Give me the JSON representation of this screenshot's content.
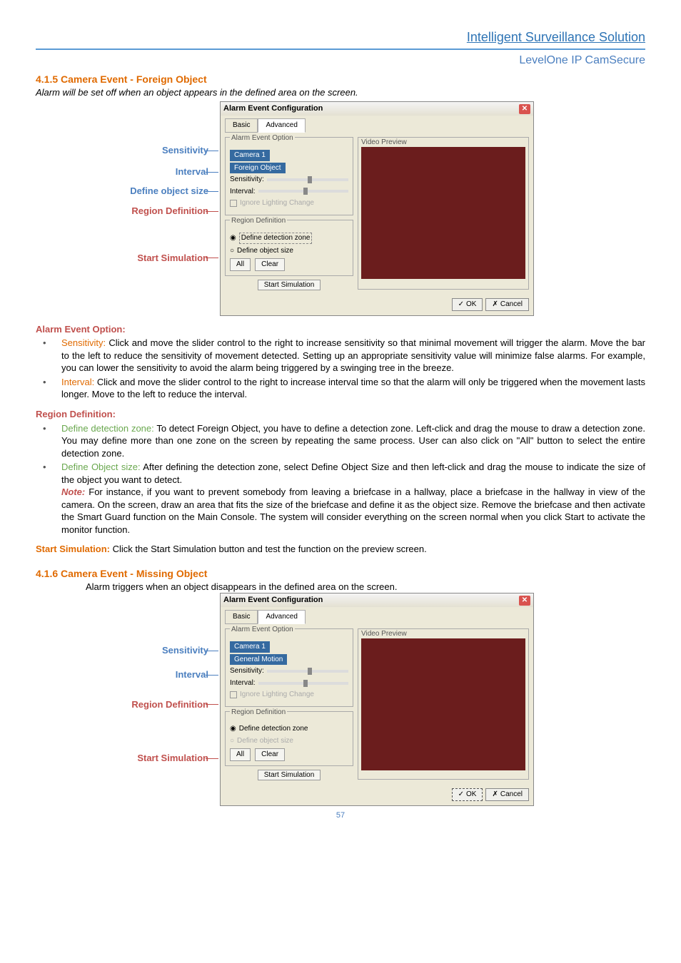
{
  "header": {
    "title1": "Intelligent Surveillance Solution",
    "title2": "LevelOne IP CamSecure"
  },
  "sec415": {
    "heading": "4.1.5 Camera Event - Foreign Object",
    "lede": "Alarm will be set off when an object appears in the defined area on the screen."
  },
  "ann": {
    "sens": "Sensitivity",
    "interval": "Interval",
    "defobj": "Define object size",
    "region": "Region Definition",
    "start": "Start Simulation"
  },
  "dlgA": {
    "title": "Alarm Event Configuration",
    "tab_basic": "Basic",
    "tab_adv": "Advanced",
    "grp_alarm": "Alarm Event Option",
    "grp_preview": "Video Preview",
    "camera": "Camera 1",
    "event": "Foreign Object",
    "lbl_sens": "Sensitivity:",
    "lbl_int": "Interval:",
    "chk_ignore": "Ignore Lighting Change",
    "grp_region": "Region Definition",
    "rad_ddz": "Define detection zone",
    "rad_dos": "Define object size",
    "btn_all": "All",
    "btn_clear": "Clear",
    "btn_start": "Start Simulation",
    "btn_ok": "OK",
    "btn_cancel": "Cancel"
  },
  "body415": {
    "aeo_head": "Alarm Event Option:",
    "sens_term": "Sensitivity:",
    "sens_text": " Click and move the slider control to the right to increase sensitivity so that minimal movement will trigger the alarm. Move the bar to the left to reduce the sensitivity of movement detected. Setting up an appropriate sensitivity value will minimize false alarms. For example, you can lower the sensitivity to avoid the alarm being triggered by a swinging tree in the breeze.",
    "int_term": "Interval:",
    "int_text": " Click and move the slider control to the right to increase interval time so that the alarm will only be triggered when the movement lasts longer. Move to the left to reduce the interval.",
    "reg_head": "Region Definition:",
    "ddz_term": "Define detection zone:",
    "ddz_text": " To detect Foreign Object, you have to define a detection zone. Left-click and drag the mouse to draw a detection zone. You may define more than one zone on the screen by repeating the same process. User can also click on \"All\" button to select the entire detection zone.",
    "dos_term": "Define Object size:",
    "dos_text": " After defining the detection zone, select Define Object Size and then left-click and drag the mouse to indicate the size of the object you want to detect.",
    "note": "Note:",
    "note_text": " For instance, if you want to prevent somebody from leaving a briefcase in a hallway, place a briefcase in the hallway in view of the camera. On the screen, draw an area that fits the size of the briefcase and define it as the object size.    Remove the briefcase and then activate the Smart Guard function on the Main Console. The system will consider everything on the screen normal when you click Start to activate the monitor function.",
    "start_head": "Start Simulation:",
    "start_text": " Click the Start Simulation button and test the function on the preview screen."
  },
  "sec416": {
    "heading": "4.1.6 Camera Event - Missing Object",
    "lede": "Alarm triggers when an object disappears in the defined area on the screen."
  },
  "dlgB": {
    "title": "Alarm Event Configuration",
    "tab_basic": "Basic",
    "tab_adv": "Advanced",
    "grp_alarm": "Alarm Event Option",
    "grp_preview": "Video Preview",
    "camera": "Camera 1",
    "event": "General Motion",
    "lbl_sens": "Sensitivity:",
    "lbl_int": "Interval:",
    "chk_ignore": "Ignore Lighting Change",
    "grp_region": "Region Definition",
    "rad_ddz": "Define detection zone",
    "rad_dos": "Define object size",
    "btn_all": "All",
    "btn_clear": "Clear",
    "btn_start": "Start Simulation",
    "btn_ok": "OK",
    "btn_cancel": "Cancel"
  },
  "page_num": "57"
}
